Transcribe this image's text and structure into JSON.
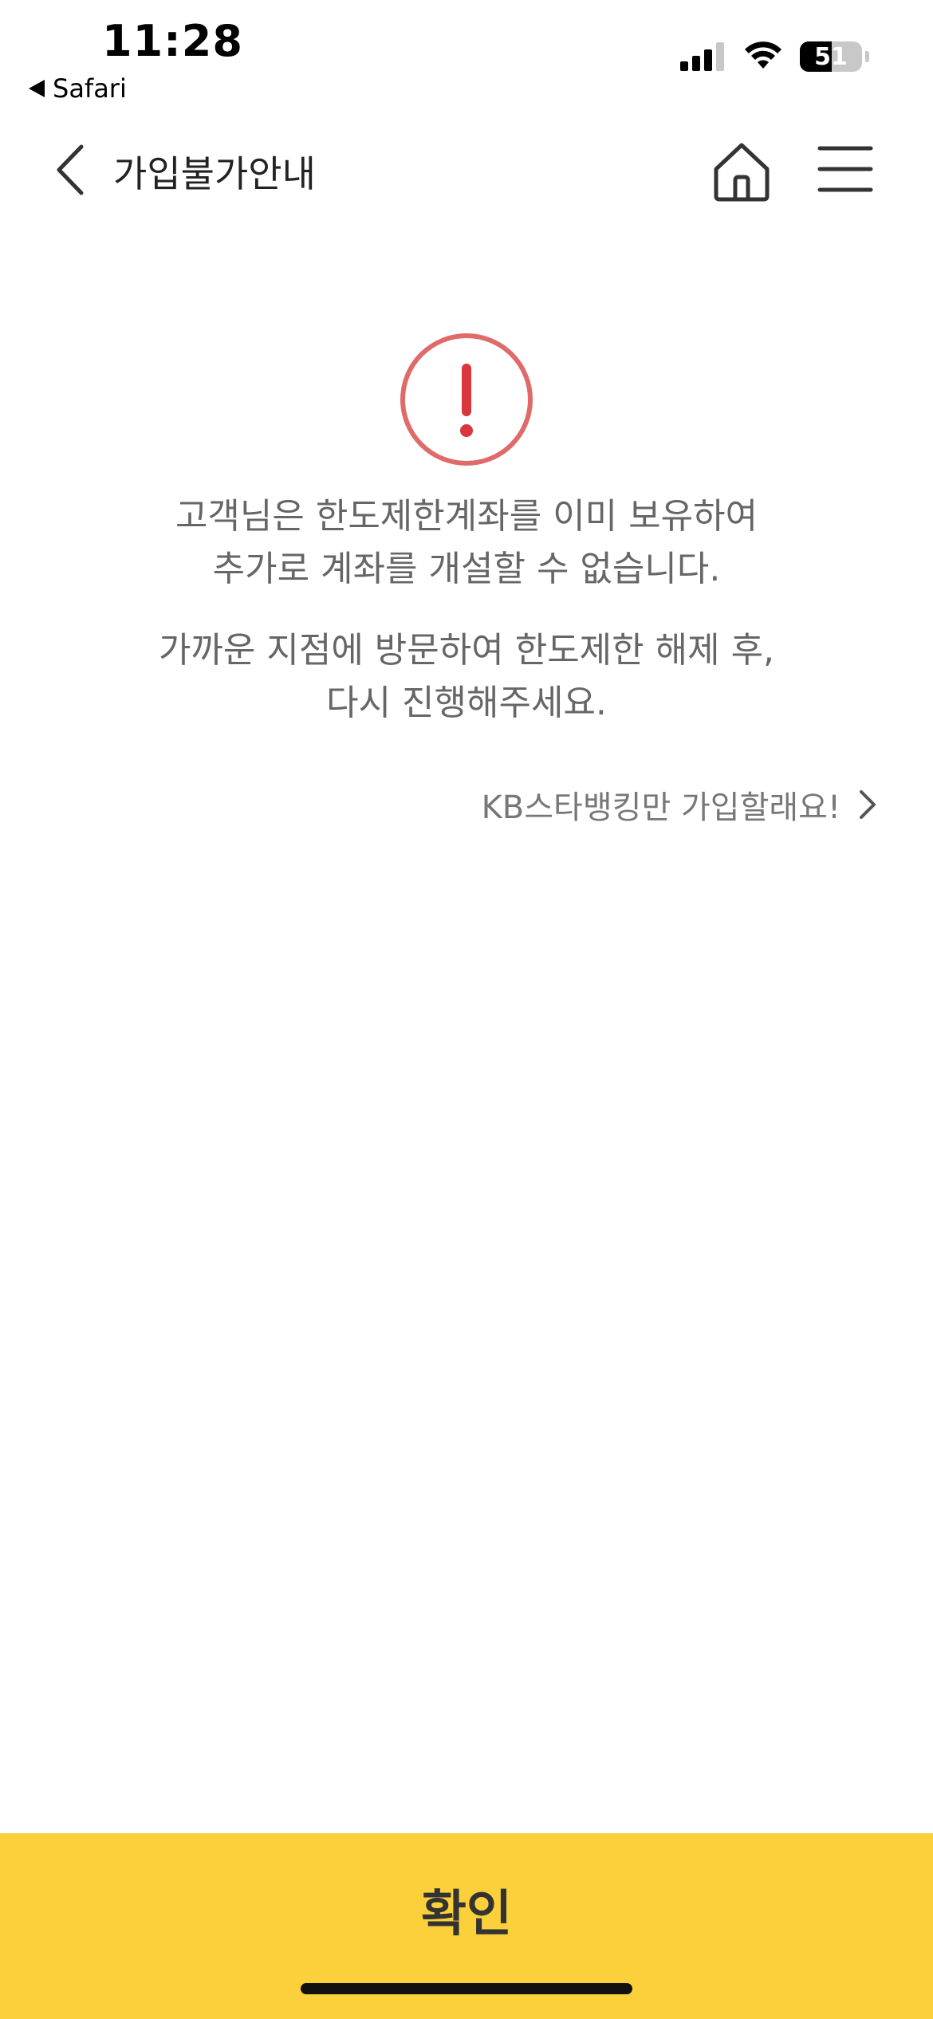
{
  "status_bar": {
    "time": "11:28",
    "back_app": "Safari",
    "battery_level": "51",
    "battery_percent": 51
  },
  "header": {
    "title": "가입불가안내"
  },
  "message": {
    "line1": "고객님은 한도제한계좌를 이미 보유하여",
    "line2": "추가로 계좌를 개설할 수 없습니다.",
    "line3": "가까운 지점에 방문하여 한도제한 해제 후,",
    "line4": "다시 진행해주세요."
  },
  "link": {
    "label": "KB스타뱅킹만 가입할래요!"
  },
  "footer": {
    "confirm_label": "확인"
  },
  "colors": {
    "accent_yellow": "#fcd03a",
    "alert_red": "#e06a6a"
  },
  "icons": [
    "back-chevron-icon",
    "home-icon",
    "menu-icon",
    "alert-icon",
    "chevron-right-icon"
  ]
}
